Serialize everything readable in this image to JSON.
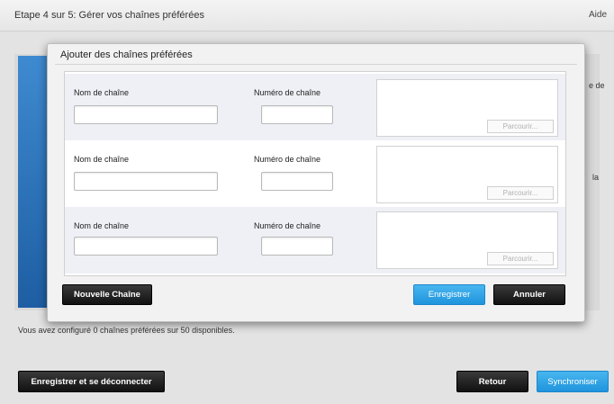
{
  "header": {
    "title": "Etape 4 sur 5: Gérer vos chaînes préférées",
    "help": "Aide"
  },
  "background": {
    "snippet_1": "e de",
    "snippet_2": "la",
    "status_text": "Vous avez configuré 0 chaînes préférées sur 50 disponibles."
  },
  "modal": {
    "title": "Ajouter des chaînes préférées",
    "rows": [
      {
        "name_label": "Nom de chaîne",
        "number_label": "Numéro de chaîne",
        "name_value": "",
        "number_value": "",
        "browse_label": "Parcourir..."
      },
      {
        "name_label": "Nom de chaîne",
        "number_label": "Numéro de chaîne",
        "name_value": "",
        "number_value": "",
        "browse_label": "Parcourir..."
      },
      {
        "name_label": "Nom de chaîne",
        "number_label": "Numéro de chaîne",
        "name_value": "",
        "number_value": "",
        "browse_label": "Parcourir..."
      }
    ],
    "new_channel_button": "Nouvelle Chaîne",
    "save_button": "Enregistrer",
    "cancel_button": "Annuler"
  },
  "footer": {
    "save_logout_button": "Enregistrer et se déconnecter",
    "back_button": "Retour",
    "sync_button": "Synchroniser"
  },
  "colors": {
    "accent_blue": "#2ba3e8",
    "dark_button": "#1a1a1a"
  }
}
